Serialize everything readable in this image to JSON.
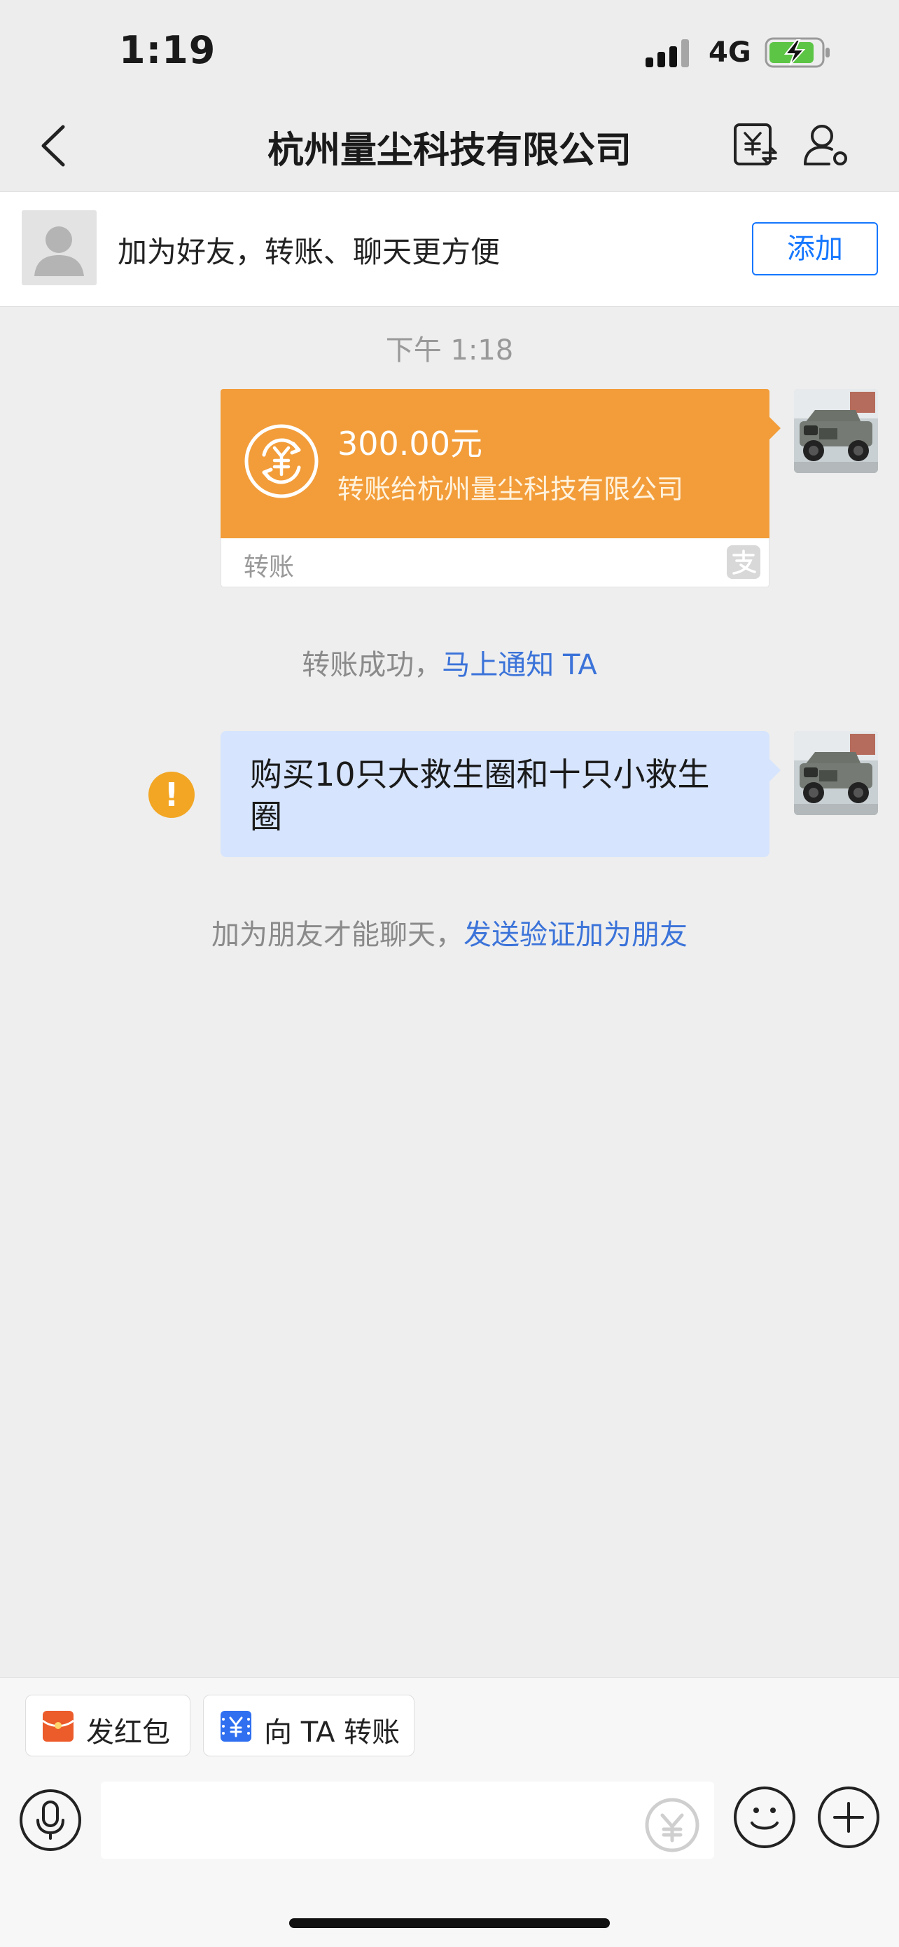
{
  "status_bar": {
    "time": "1:19",
    "network": "4G",
    "icons": [
      "signal-icon",
      "battery-charging-icon"
    ]
  },
  "nav": {
    "title": "杭州量尘科技有限公司",
    "icons": [
      "back-icon",
      "transfer-icon",
      "profile-settings-icon"
    ]
  },
  "add_friend_banner": {
    "text": "加为好友，转账、聊天更方便",
    "button_label": "添加",
    "accent_color": "#1677ff"
  },
  "chat": {
    "time_divider": "下午 1:18",
    "transfer_card": {
      "amount": "300.00元",
      "description": "转账给杭州量尘科技有限公司",
      "footer_label": "转账",
      "card_color": "#f29d3a"
    },
    "transfer_notice": {
      "text": "转账成功，",
      "link": "马上通知 TA"
    },
    "message": {
      "text": "购买10只大救生圈和十只小救生圈",
      "status": "warning-icon",
      "bubble_color": "#d6e4fd"
    },
    "friend_notice": {
      "text": "加为朋友才能聊天，",
      "link": "发送验证加为朋友"
    }
  },
  "bottom": {
    "quick_actions": [
      {
        "label": "发红包",
        "icon": "red-packet-icon",
        "color": "#ec5b2a"
      },
      {
        "label": "向 TA 转账",
        "icon": "transfer-yuan-icon",
        "color": "#2f6ff0"
      }
    ],
    "input_placeholder": "",
    "icons": [
      "microphone-icon",
      "yuan-circle-icon",
      "emoji-icon",
      "plus-icon"
    ]
  }
}
